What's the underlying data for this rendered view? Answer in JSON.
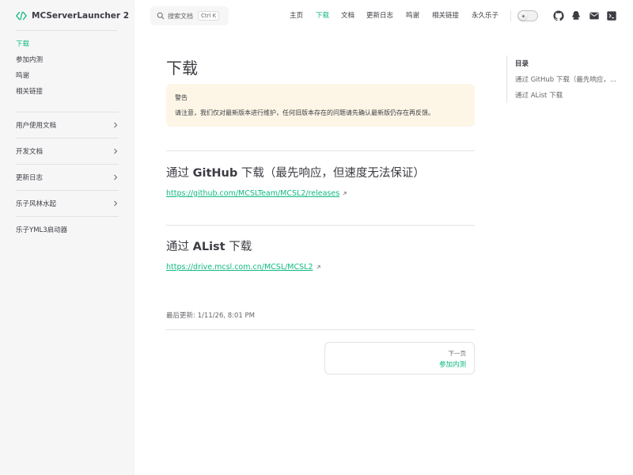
{
  "app": {
    "title": "MCServerLauncher 2"
  },
  "search": {
    "placeholder": "搜索文档",
    "shortcut": "Ctrl K"
  },
  "nav": {
    "items": [
      {
        "label": "主页",
        "active": false
      },
      {
        "label": "下载",
        "active": true
      },
      {
        "label": "文档",
        "active": false
      },
      {
        "label": "更新日志",
        "active": false
      },
      {
        "label": "鸣谢",
        "active": false
      },
      {
        "label": "相关链接",
        "active": false
      },
      {
        "label": "永久乐子",
        "active": false
      }
    ],
    "social": [
      "github-icon",
      "qq-icon",
      "mail-icon",
      "terminal-icon"
    ]
  },
  "sidebar": {
    "links": [
      {
        "label": "下载",
        "active": true
      },
      {
        "label": "参加内测",
        "active": false
      },
      {
        "label": "鸣谢",
        "active": false
      },
      {
        "label": "相关链接",
        "active": false
      }
    ],
    "sections": [
      {
        "label": "用户使用文档",
        "expandable": true
      },
      {
        "label": "开发文档",
        "expandable": true
      },
      {
        "label": "更新日志",
        "expandable": true
      },
      {
        "label": "乐子风林水起",
        "expandable": true
      },
      {
        "label": "乐子YML3启动器",
        "expandable": false
      }
    ]
  },
  "content": {
    "title": "下载",
    "warning": {
      "title": "警告",
      "body": "请注意，我们仅对最新版本进行维护，任何旧版本存在的问题请先确认最新版仍存在再反馈。"
    },
    "sections": [
      {
        "prefix": "通过 ",
        "bold": "GitHub",
        "suffix": " 下载（最先响应，但速度无法保证）",
        "link": "https://github.com/MCSLTeam/MCSL2/releases"
      },
      {
        "prefix": "通过 ",
        "bold": "AList",
        "suffix": " 下载",
        "link": "https://drive.mcsl.com.cn/MCSL/MCSL2"
      }
    ],
    "last_updated_label": "最后更新:",
    "last_updated_value": "1/11/26, 8:01 PM",
    "next": {
      "label": "下一页",
      "title": "参加内测"
    }
  },
  "outline": {
    "title": "目录",
    "items": [
      "通过 GitHub 下载（最先响应，...",
      "通过 AList 下载"
    ]
  },
  "colors": {
    "accent": "#10b981",
    "sidebar_bg": "#f6f6f7",
    "warning_bg": "#fdf6e6",
    "text": "#3c3c43"
  }
}
